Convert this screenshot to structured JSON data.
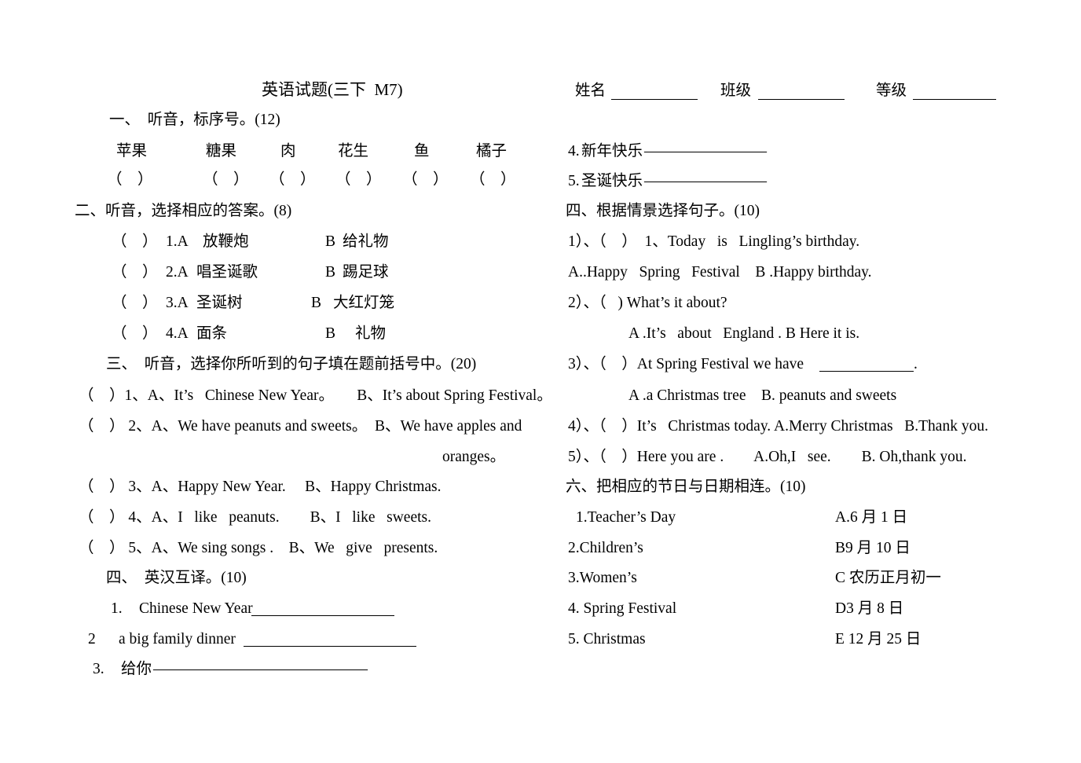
{
  "document": {
    "title": "英语试题(三下  M7)",
    "header_fields": [
      {
        "label": "姓名"
      },
      {
        "label": "班级"
      },
      {
        "label": "等级"
      }
    ]
  },
  "left_column": {
    "section1": {
      "heading": "一、  听音，标序号。(12)",
      "words": [
        "苹果",
        "糖果",
        "肉",
        "花生",
        "鱼",
        "橘子"
      ],
      "blanks": [
        "（    ）",
        "（    ）",
        "（    ）",
        "（    ）",
        "（    ）",
        "（    ）"
      ]
    },
    "section2": {
      "heading": "二、听音，选择相应的答案。(8)",
      "items": [
        {
          "bracket": "（    ）",
          "number": "1.A",
          "option_a": "放鞭炮",
          "option_b_label": "B",
          "option_b": "给礼物"
        },
        {
          "bracket": "（    ）",
          "number": "2.A",
          "option_a": "唱圣诞歌",
          "option_b_label": "B",
          "option_b": "踢足球"
        },
        {
          "bracket": "（    ）",
          "number": "3.A",
          "option_a": "圣诞树",
          "option_b_label": "B",
          "option_b": "大红灯笼"
        },
        {
          "bracket": "（    ）",
          "number": "4.A",
          "option_a": "面条",
          "option_b_label": "B",
          "option_b": "礼物"
        }
      ]
    },
    "section3": {
      "heading": "三、  听音，选择你所听到的句子填在题前括号中。(20)",
      "items": [
        {
          "line": "（    ）1、A、It’s   Chinese New Year。      B、It’s about Spring Festival。"
        },
        {
          "line": "（    ） 2、A、We have peanuts and sweets。  B、We have apples and"
        },
        {
          "line": "oranges。",
          "wrap": true
        },
        {
          "line": "（    ） 3、A、Happy New Year.     B、Happy Christmas."
        },
        {
          "line": "（    ） 4、A、I   like   peanuts.        B、I   like   sweets."
        },
        {
          "line": "（    ） 5、A、We sing songs .    B、We   give   presents."
        }
      ]
    },
    "section4": {
      "heading": "四、  英汉互译。(10)",
      "items": [
        {
          "number": "1.",
          "text": "Chinese New Year",
          "fill": "blank-line"
        },
        {
          "number": "2",
          "text": "a big family dinner",
          "fill": "blank-line"
        },
        {
          "number": "3.",
          "text": "给你",
          "fill": "dash-line",
          "dashes": "——————————————"
        }
      ]
    }
  },
  "right_column": {
    "translation_continued": [
      {
        "number": "4.",
        "text": "新年快乐",
        "dashes": "————————"
      },
      {
        "number": "5.",
        "text": "圣诞快乐",
        "dashes": "————————"
      }
    ],
    "section4": {
      "heading": "四、根据情景选择句子。(10)",
      "items": [
        {
          "line": "1）、（    ）  1、Today   is   Lingling’s birthday."
        },
        {
          "line": "A..Happy   Spring   Festival    B .Happy birthday."
        },
        {
          "line": "2）、（   ) What’s it about?"
        },
        {
          "line": "A .It’s   about   England . B Here it is.",
          "indent": true
        },
        {
          "line": "3）、（    ）At Spring Festival we have",
          "has_blank": true,
          "after_blank": "."
        },
        {
          "line": "A .a Christmas tree    B. peanuts and sweets",
          "indent": true
        },
        {
          "line": "4）、（    ）It’s   Christmas today. A.Merry Christmas   B.Thank you."
        },
        {
          "line": "5）、（    ）Here you are .        A.Oh,I   see.        B. Oh,thank you."
        }
      ]
    },
    "section6": {
      "heading": "六、把相应的节日与日期相连。(10)",
      "left_items": [
        "1.Teacher’s Day",
        "2.Children’s",
        "3.Women’s",
        "4. Spring Festival",
        "5. Christmas"
      ],
      "right_items": [
        "A.6 月 1 日",
        "B9 月 10 日",
        "C 农历正月初一",
        "D3 月 8 日",
        "E 12 月 25 日"
      ]
    }
  }
}
